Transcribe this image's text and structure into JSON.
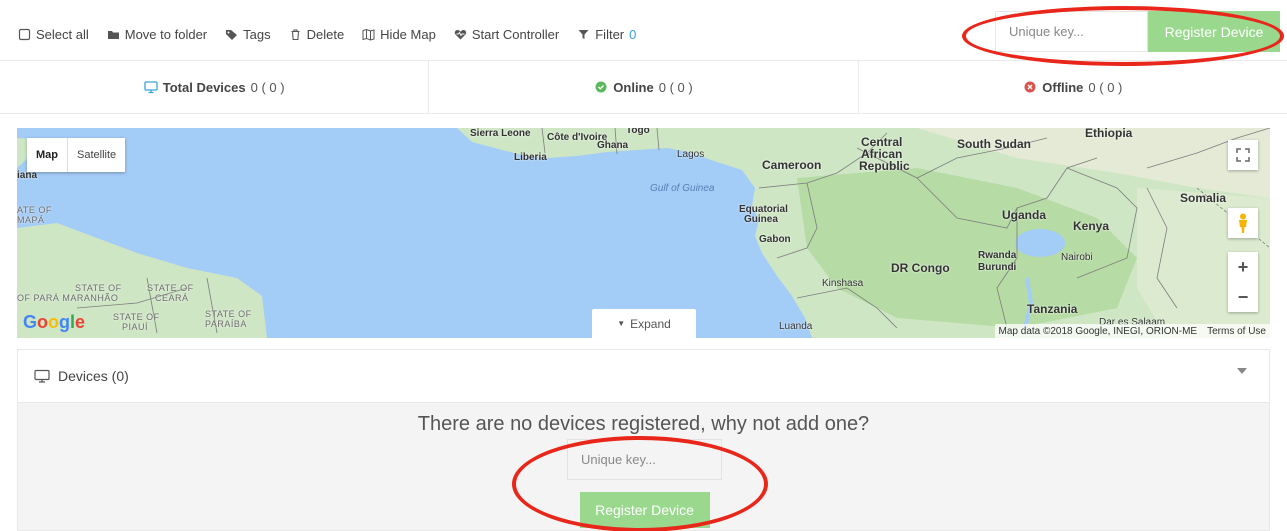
{
  "toolbar": {
    "items": [
      {
        "label": "Select all",
        "icon": "checkbox-icon"
      },
      {
        "label": "Move to folder",
        "icon": "folder-icon"
      },
      {
        "label": "Tags",
        "icon": "tags-icon"
      },
      {
        "label": "Delete",
        "icon": "trash-icon"
      },
      {
        "label": "Hide Map",
        "icon": "map-icon"
      },
      {
        "label": "Start Controller",
        "icon": "controller-icon"
      },
      {
        "label": "Filter",
        "icon": "filter-icon"
      }
    ],
    "filter_count": "0",
    "key_placeholder": "Unique key...",
    "register_label": "Register Device"
  },
  "stats": {
    "total_label": "Total Devices",
    "total_value": "0 ( 0 )",
    "online_label": "Online",
    "online_value": "0 ( 0 )",
    "offline_label": "Offline",
    "offline_value": "0 ( 0 )"
  },
  "map": {
    "type_map": "Map",
    "type_satellite": "Satellite",
    "expand_label": "Expand",
    "attribution": "Map data ©2018 Google, INEGI, ORION-ME",
    "terms": "Terms of Use",
    "logo": "Google",
    "labels": {
      "sierra_leone": "Sierra Leone",
      "cote_divoire": "Côte d'Ivoire",
      "togo": "Togo",
      "ghana": "Ghana",
      "liberia": "Liberia",
      "lagos": "Lagos",
      "gulf": "Gulf of Guinea",
      "cameroon": "Cameroon",
      "car1": "Central",
      "car2": "African",
      "car3": "Republic",
      "south_sudan": "South Sudan",
      "ethiopia": "Ethiopia",
      "somalia": "Somalia",
      "uganda": "Uganda",
      "kenya": "Kenya",
      "nairobi": "Nairobi",
      "eq_guinea1": "Equatorial",
      "eq_guinea2": "Guinea",
      "gabon": "Gabon",
      "rwanda": "Rwanda",
      "burundi": "Burundi",
      "dr_congo": "DR Congo",
      "kinshasa": "Kinshasa",
      "tanzania": "Tanzania",
      "luanda": "Luanda",
      "iana": "iana",
      "amapa1": "ATE OF",
      "amapa2": "MAPÁ",
      "ceara1": "STATE OF",
      "ceara2": "CEARÁ",
      "maranhao1": "STATE OF",
      "maranhao2": "OF PARÁ  MARANHÃO",
      "piaui1": "STATE OF",
      "piaui2": "PIAUÍ",
      "paraiba1": "STATE OF",
      "paraiba2": "PARAÍBA",
      "dar": "Dar es Salaam"
    }
  },
  "devices": {
    "title": "Devices (0)",
    "empty_message": "There are no devices registered, why not add one?",
    "key_placeholder": "Unique key...",
    "register_label": "Register Device"
  },
  "colors": {
    "accent_green": "#9ad88e",
    "online_green": "#5cb85c",
    "offline_red": "#d9534f",
    "info_blue": "#3ba3d8",
    "annotation_red": "#e8261a"
  }
}
